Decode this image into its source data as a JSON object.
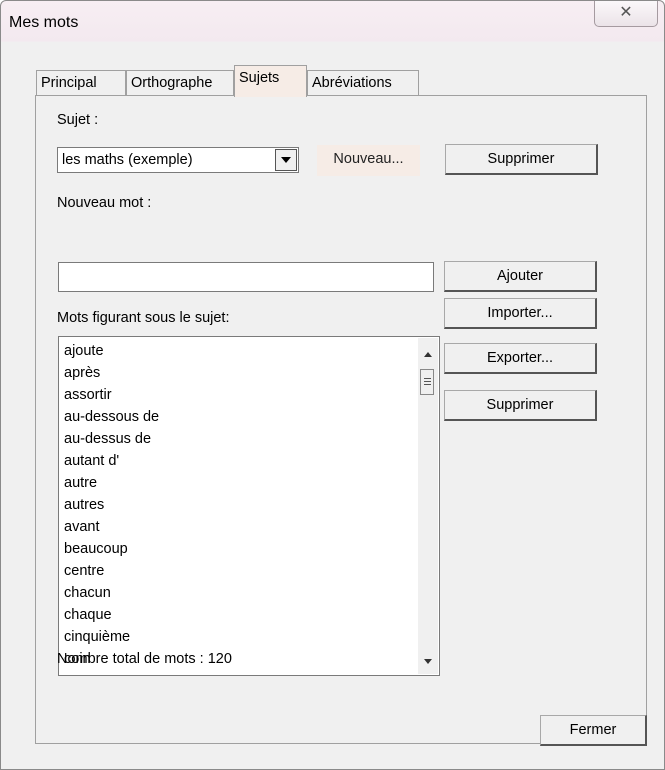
{
  "window": {
    "title": "Mes mots",
    "close_glyph": "✕"
  },
  "tabs": [
    {
      "label": "Principal"
    },
    {
      "label": "Orthographe"
    },
    {
      "label": "Sujets",
      "active": true
    },
    {
      "label": "Abréviations"
    }
  ],
  "subject": {
    "label": "Sujet :",
    "selected": "les maths (exemple)",
    "new_button": "Nouveau...",
    "delete_button": "Supprimer"
  },
  "new_word": {
    "label": "Nouveau mot :",
    "value": "",
    "add_button": "Ajouter"
  },
  "words": {
    "label": "Mots figurant sous le sujet:",
    "items": [
      "ajoute",
      "après",
      "assortir",
      "au-dessous de",
      "au-dessus de",
      "autant d'",
      "autre",
      "autres",
      "avant",
      "beaucoup",
      "centre",
      "chacun",
      "chaque",
      "cinquième",
      "coin"
    ],
    "import_button": "Importer...",
    "export_button": "Exporter...",
    "delete_button": "Supprimer",
    "total_label": "Nombre total de mots : 120"
  },
  "footer": {
    "close_button": "Fermer"
  },
  "icons": {
    "close": "close-icon",
    "dropdown": "chevron-down-icon",
    "scroll_up": "scroll-up-icon",
    "scroll_down": "scroll-down-icon"
  }
}
